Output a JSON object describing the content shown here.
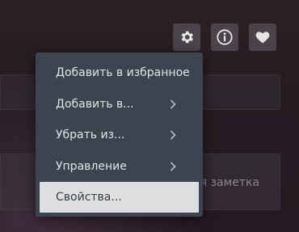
{
  "toolbar": {
    "buttons": [
      {
        "icon": "gear-icon",
        "label": "Settings"
      },
      {
        "icon": "info-icon",
        "label": "Info"
      },
      {
        "icon": "heart-icon",
        "label": "Favorite"
      }
    ]
  },
  "note": {
    "placeholder_visible": "ая заметка"
  },
  "context_menu": {
    "items": [
      {
        "label": "Добавить в избранное",
        "has_submenu": false
      },
      {
        "label": "Добавить в...",
        "has_submenu": true
      },
      {
        "label": "Убрать из...",
        "has_submenu": true
      },
      {
        "label": "Управление",
        "has_submenu": true
      },
      {
        "label": "Свойства...",
        "has_submenu": false,
        "highlighted": true
      }
    ]
  },
  "colors": {
    "menu_background": "#3d4450",
    "menu_highlight": "#dcdedf",
    "toolbar_button": "#4a434a",
    "icon": "#e6e6e6"
  }
}
